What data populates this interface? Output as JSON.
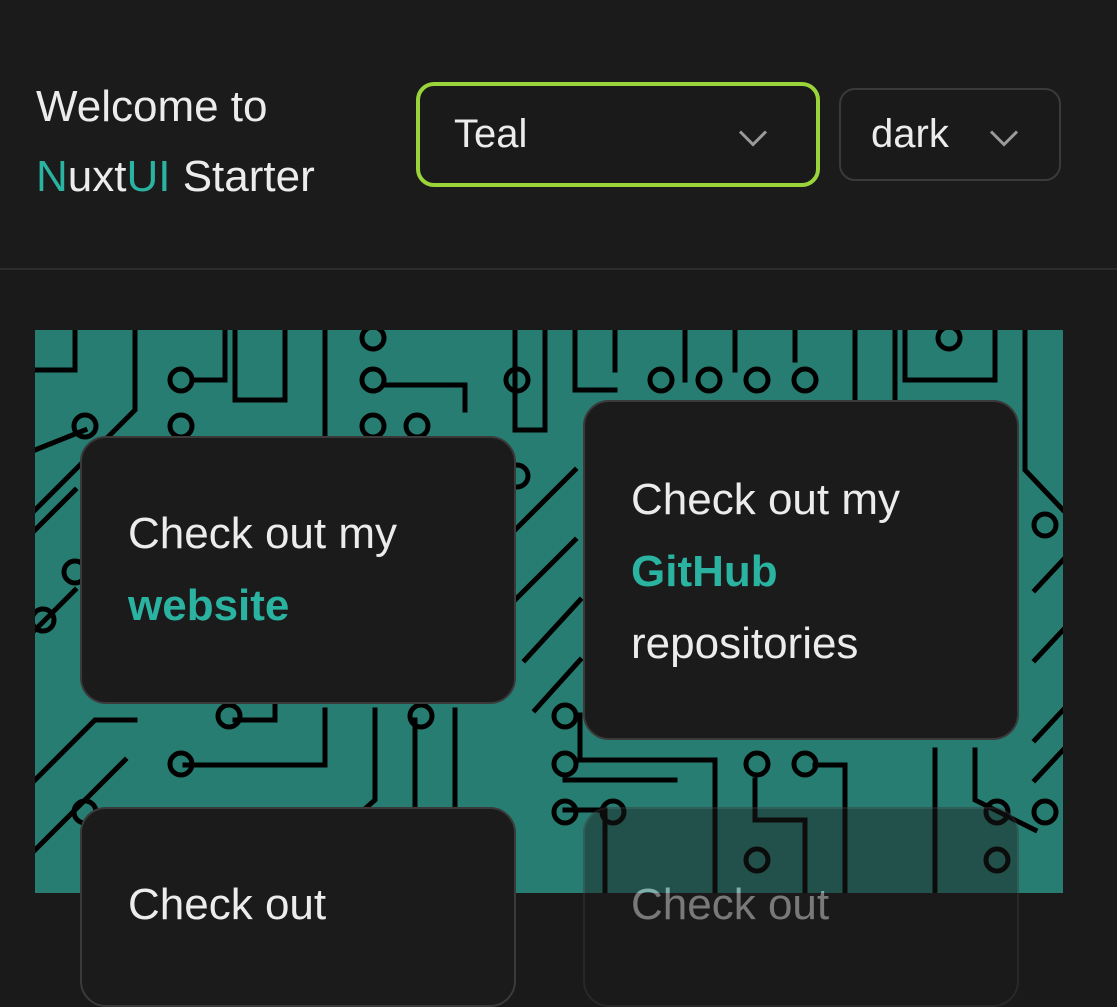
{
  "header": {
    "welcome_line1": "Welcome to",
    "brand_n": "N",
    "brand_uxt": "uxt",
    "brand_ui": "UI",
    "brand_starter": " Starter"
  },
  "selects": {
    "color": {
      "value": "Teal"
    },
    "mode": {
      "value": "dark"
    }
  },
  "cards": [
    {
      "prefix": "Check out my",
      "link": "website",
      "suffix": ""
    },
    {
      "prefix": "Check out my",
      "link": "GitHub",
      "suffix": "repositories"
    },
    {
      "prefix": "Check out",
      "link": "",
      "suffix": ""
    },
    {
      "prefix": "Check out",
      "link": "",
      "suffix": ""
    }
  ],
  "colors": {
    "accent": "#2ab3a1",
    "focus_ring": "#9ad43a",
    "pattern_bg": "#287d72",
    "surface": "#1b1b1b"
  }
}
